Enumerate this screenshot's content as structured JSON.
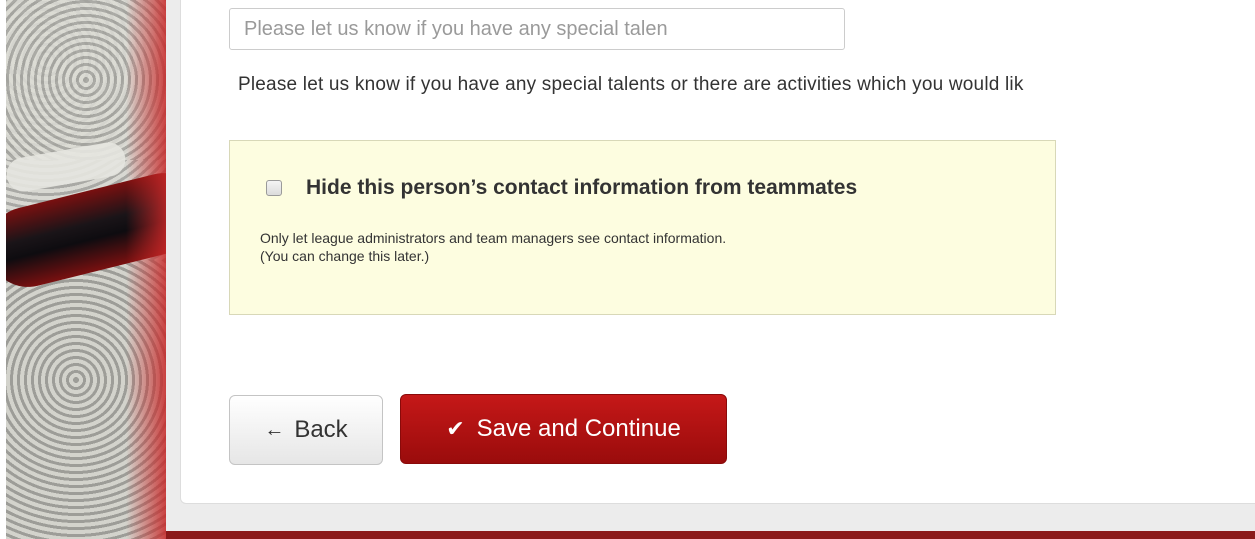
{
  "form": {
    "talents_placeholder": "Please let us know if you have any special talen",
    "talents_help": "Please let us know if you have any special talents or there are activities which you would lik"
  },
  "notice": {
    "checkbox_label": "Hide this person’s contact information from teammates",
    "checked": false,
    "description_line1": "Only let league administrators and team managers see contact information.",
    "description_line2": "(You can change this later.)"
  },
  "actions": {
    "back_label": "Back",
    "back_icon": "arrow-left-icon",
    "save_label": "Save and Continue",
    "save_icon": "checkmark-icon"
  },
  "colors": {
    "accent_red": "#b01212",
    "notice_bg": "#fdfde0"
  }
}
